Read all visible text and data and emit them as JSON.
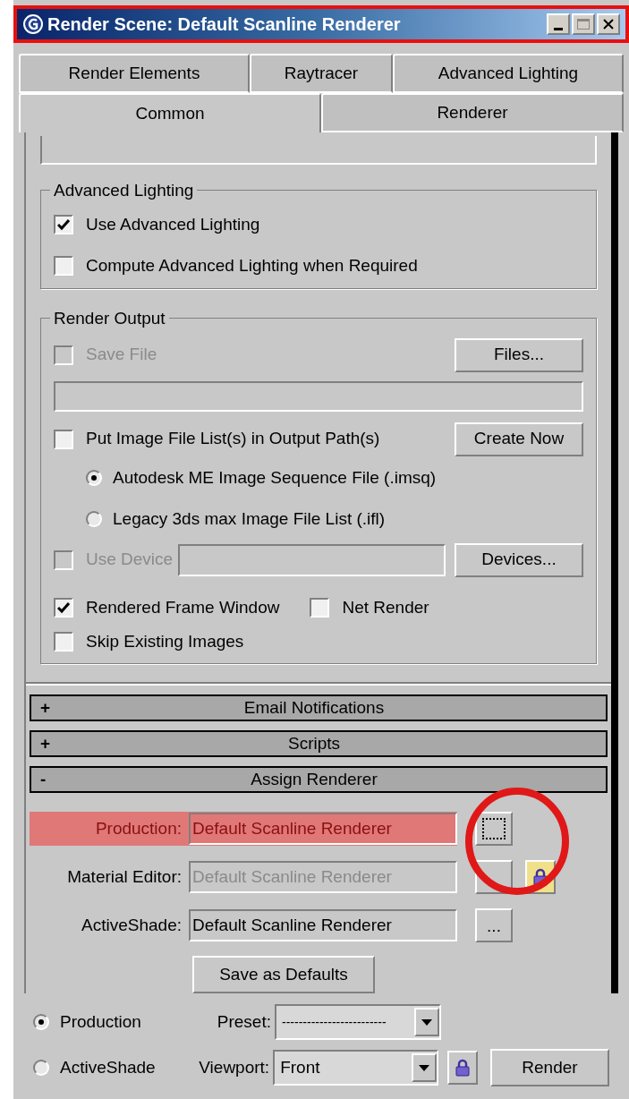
{
  "window": {
    "title": "Render Scene: Default Scanline Renderer"
  },
  "tabs": [
    [
      {
        "label": "Render Elements",
        "selected": false
      },
      {
        "label": "Raytracer",
        "selected": false
      },
      {
        "label": "Advanced Lighting",
        "selected": false
      }
    ],
    [
      {
        "label": "Common",
        "selected": true
      },
      {
        "label": "Renderer",
        "selected": false
      }
    ]
  ],
  "advanced_lighting": {
    "title": "Advanced Lighting",
    "options": [
      {
        "label": "Use Advanced Lighting",
        "checked": true,
        "disabled": false
      },
      {
        "label": "Compute Advanced Lighting when Required",
        "checked": false,
        "disabled": false
      }
    ]
  },
  "render_output": {
    "title": "Render Output",
    "save_file": {
      "label": "Save File",
      "checked": false,
      "disabled": true
    },
    "files_button": "Files...",
    "put_image_list": {
      "label": "Put Image File List(s) in Output Path(s)",
      "checked": false,
      "disabled": false
    },
    "create_now_button": "Create Now",
    "list_formats": [
      {
        "label": "Autodesk ME Image Sequence File (.imsq)",
        "selected": true
      },
      {
        "label": "Legacy 3ds max Image File List (.ifl)",
        "selected": false
      }
    ],
    "use_device": {
      "label": "Use Device",
      "checked": false,
      "disabled": true
    },
    "devices_button": "Devices...",
    "rendered_frame_window": {
      "label": "Rendered Frame Window",
      "checked": true,
      "disabled": false
    },
    "net_render": {
      "label": "Net Render",
      "checked": false,
      "disabled": false
    },
    "skip_existing": {
      "label": "Skip Existing Images",
      "checked": false,
      "disabled": false
    }
  },
  "rollouts": [
    {
      "sign": "+",
      "label": "Email Notifications"
    },
    {
      "sign": "+",
      "label": "Scripts"
    },
    {
      "sign": "-",
      "label": "Assign Renderer"
    }
  ],
  "assign_renderer": {
    "rows": [
      {
        "label": "Production:",
        "value": "Default Scanline Renderer",
        "disabled": false,
        "highlighted": true,
        "button_focused": true,
        "circled": true,
        "lock": false
      },
      {
        "label": "Material Editor:",
        "value": "Default Scanline Renderer",
        "disabled": true,
        "highlighted": false,
        "button_focused": false,
        "circled": false,
        "lock": true
      },
      {
        "label": "ActiveShade:",
        "value": "Default Scanline Renderer",
        "disabled": false,
        "highlighted": false,
        "button_focused": false,
        "circled": false,
        "button_text": "...",
        "lock": false
      }
    ],
    "save_button": "Save as Defaults"
  },
  "bottom": {
    "modes": [
      {
        "label": "Production",
        "selected": true
      },
      {
        "label": "ActiveShade",
        "selected": false
      }
    ],
    "preset": {
      "label": "Preset:",
      "value": "-------------------------"
    },
    "viewport": {
      "label": "Viewport:",
      "value": "Front",
      "locked": false
    },
    "render_button": "Render"
  }
}
